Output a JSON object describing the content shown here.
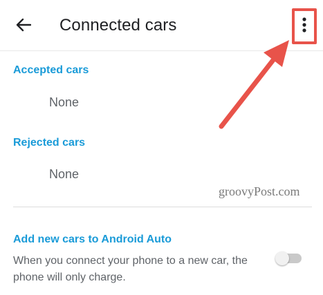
{
  "header": {
    "back_icon": "arrow-back-icon",
    "title": "Connected cars",
    "menu_icon": "more-vert-icon"
  },
  "sections": {
    "accepted": {
      "title": "Accepted cars",
      "value": "None"
    },
    "rejected": {
      "title": "Rejected cars",
      "value": "None"
    }
  },
  "watermark": "groovyPost.com",
  "setting": {
    "title": "Add new cars to Android Auto",
    "description": "When you connect your phone to a new car, the phone will only charge.",
    "toggle_state": "off"
  },
  "colors": {
    "accent": "#1a9bd8",
    "annotation": "#e8534a"
  }
}
